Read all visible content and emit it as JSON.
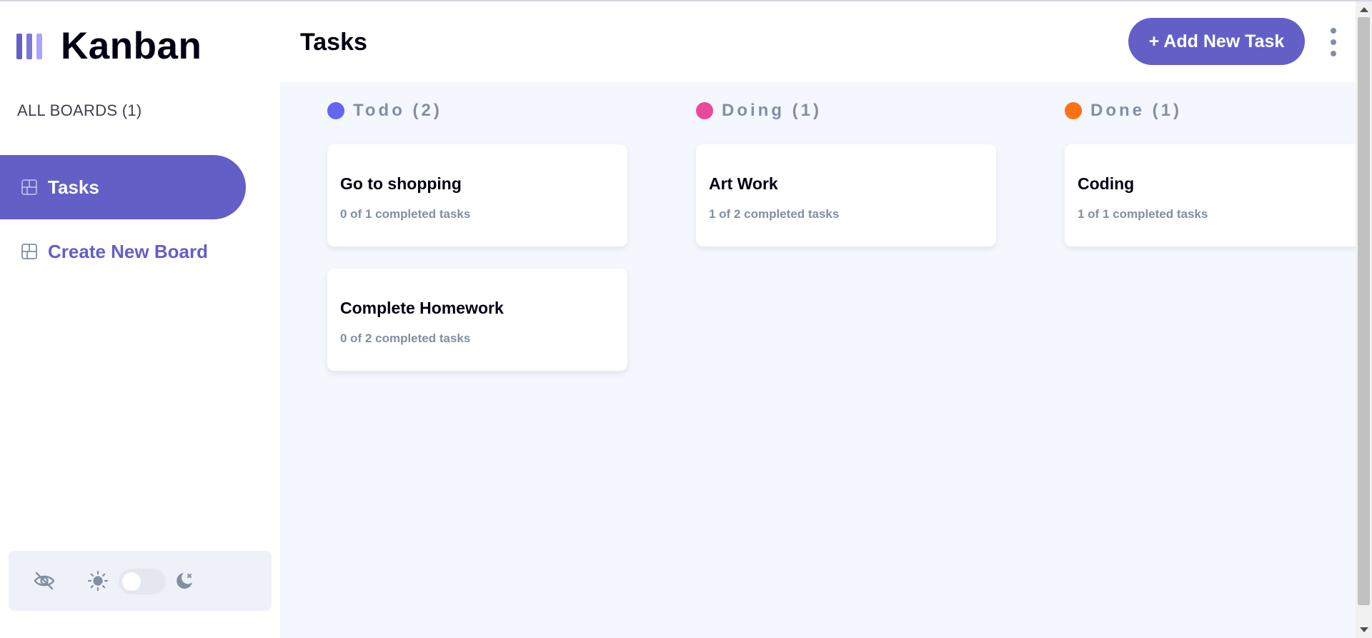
{
  "app": {
    "title": "Kanban"
  },
  "colors": {
    "accent": "#635fc7",
    "accent_light": "#a8a4ff",
    "todo": "#6366f1",
    "doing": "#ec4899",
    "done": "#f97316",
    "muted_text": "#828fa3",
    "board_bg": "#f4f7fd"
  },
  "sidebar": {
    "boards_heading": "ALL BOARDS (1)",
    "items": [
      {
        "label": "Tasks",
        "icon": "board-icon",
        "active": true
      },
      {
        "label": "Create New Board",
        "icon": "board-icon",
        "active": false
      }
    ],
    "theme": {
      "hide_icon": "eye-slash-icon",
      "light_icon": "sun-icon",
      "dark_icon": "moon-icon",
      "dark_mode": false
    }
  },
  "header": {
    "title": "Tasks",
    "add_button_label": "+ Add New Task",
    "more_icon": "vertical-ellipsis-icon"
  },
  "board": {
    "columns": [
      {
        "name": "Todo (2)",
        "color": "#6366f1",
        "cards": [
          {
            "title": "Go to shopping",
            "subtitle": "0 of 1 completed tasks"
          },
          {
            "title": "Complete Homework",
            "subtitle": "0 of 2 completed tasks"
          }
        ]
      },
      {
        "name": "Doing (1)",
        "color": "#ec4899",
        "cards": [
          {
            "title": "Art Work",
            "subtitle": "1 of 2 completed tasks"
          }
        ]
      },
      {
        "name": "Done (1)",
        "color": "#f97316",
        "cards": [
          {
            "title": "Coding",
            "subtitle": "1 of 1 completed tasks"
          }
        ]
      }
    ]
  }
}
